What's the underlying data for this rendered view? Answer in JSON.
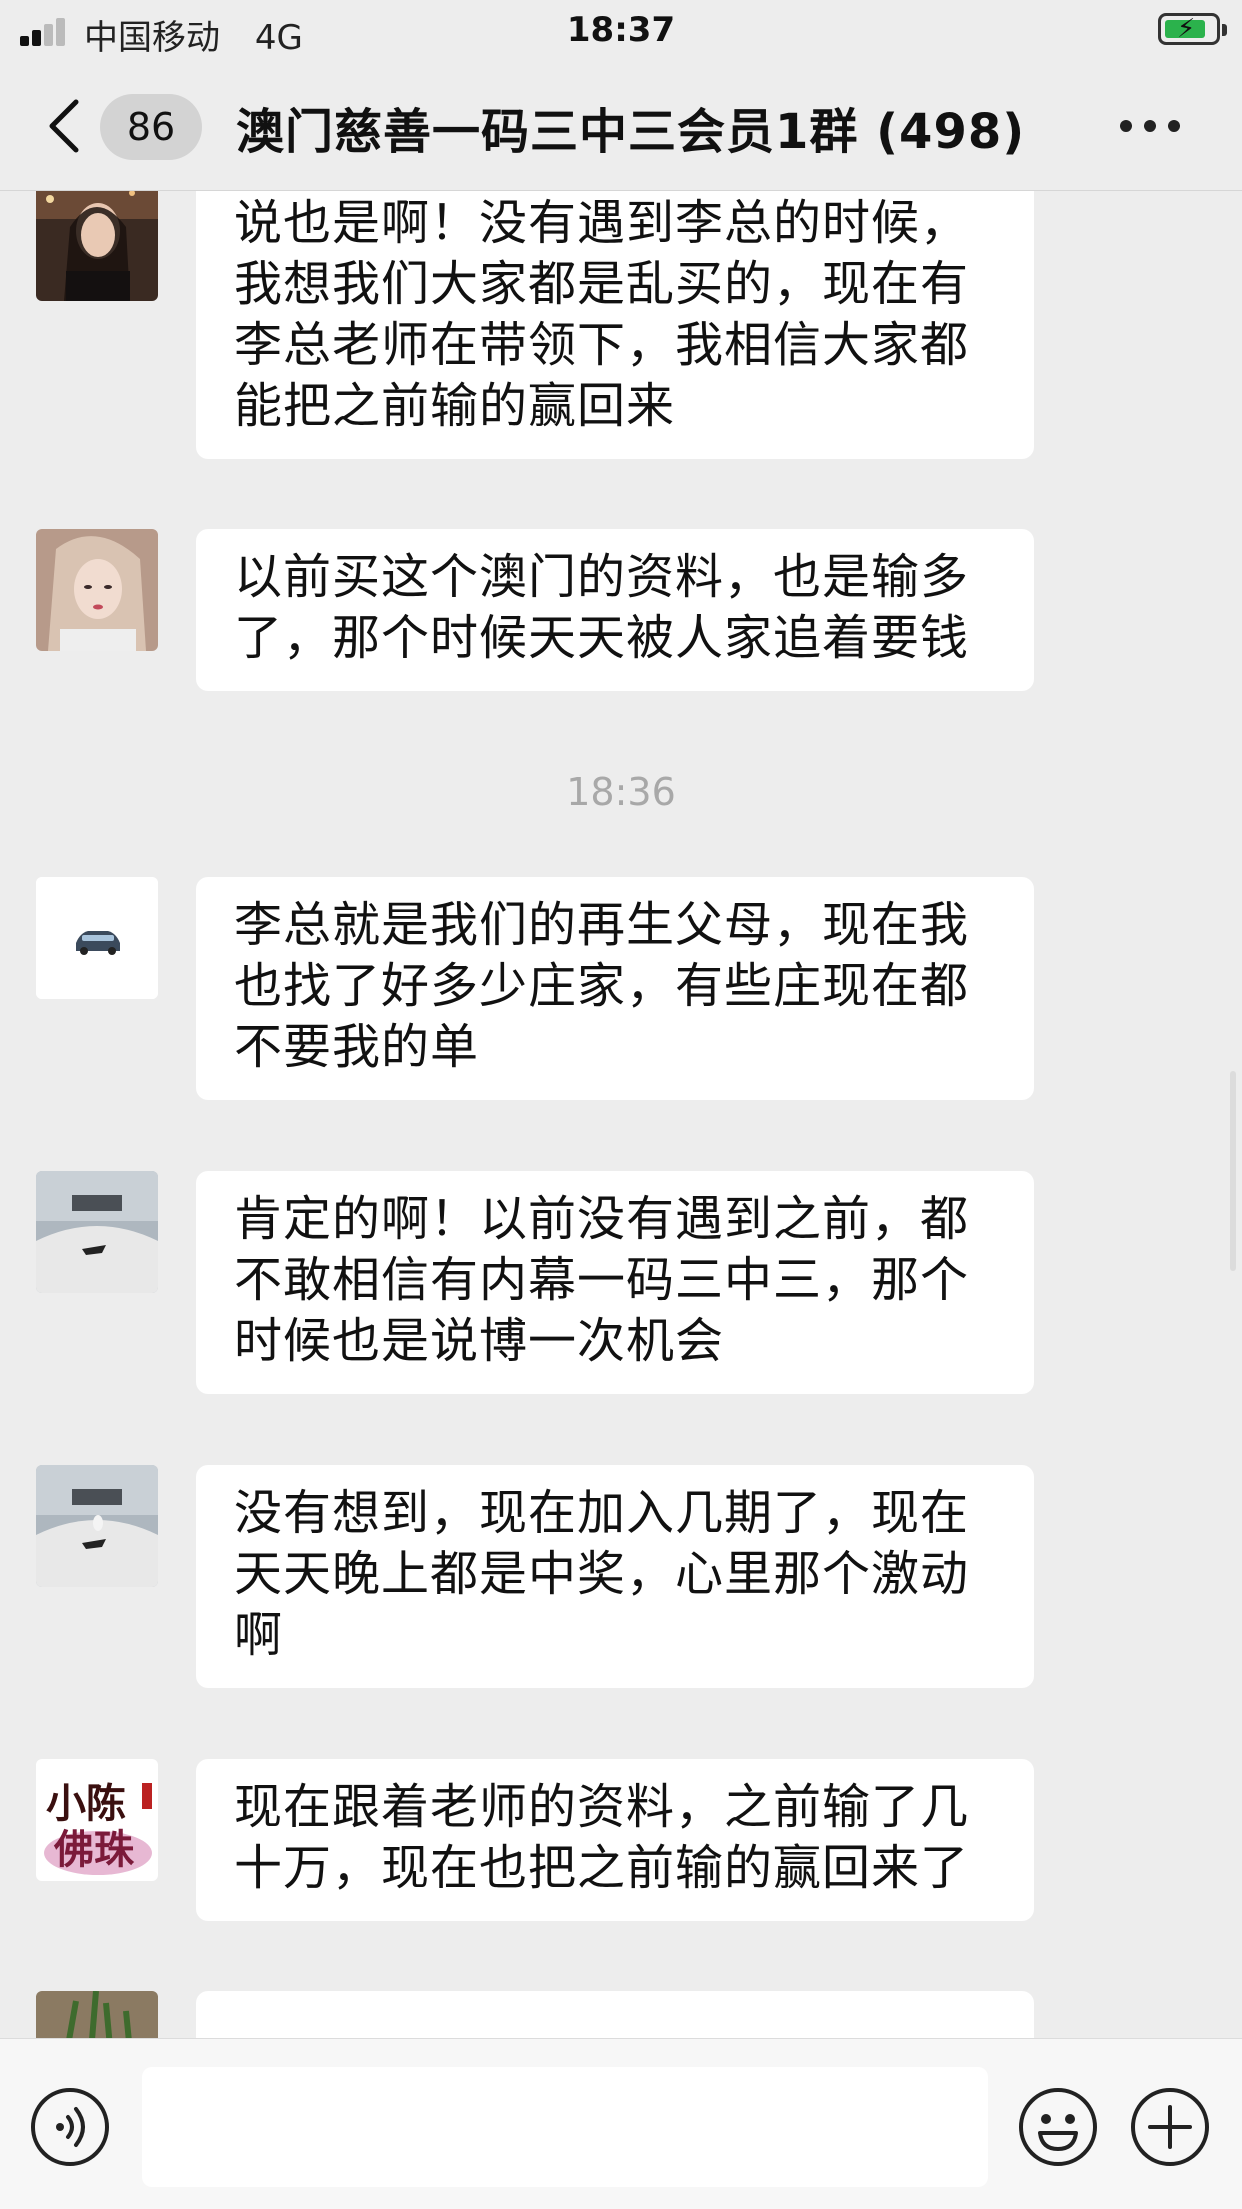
{
  "status_bar": {
    "carrier": "中国移动",
    "network": "4G",
    "time": "18:37",
    "battery_level": 0.7,
    "battery_color": "#2bb24c"
  },
  "nav": {
    "back_icon": "chevron-left-icon",
    "unread_count": "86",
    "title": "澳门慈善一码三中三会员1群 (498)",
    "more_icon": "more-dots-icon"
  },
  "messages": [
    {
      "avatar": "woman-dark-portrait",
      "text": "说也是啊！没有遇到李总的时候，我想我们大家都是乱买的，现在有李总老师在带领下，我相信大家都能把之前输的赢回来"
    },
    {
      "avatar": "woman-blonde-portrait",
      "text": "以前买这个澳门的资料，也是输多了，那个时候天天被人家追着要钱"
    },
    {
      "avatar": "car-icon-avatar",
      "text": "李总就是我们的再生父母，现在我也找了好多少庄家，有些庄现在都不要我的单"
    },
    {
      "avatar": "yacht-photo",
      "text": "肯定的啊！以前没有遇到之前，都不敢相信有内幕一码三中三，那个时候也是说博一次机会"
    },
    {
      "avatar": "yacht-photo",
      "text": "没有想到，现在加入几期了，现在天天晚上都是中奖，心里那个激动啊"
    },
    {
      "avatar": "calligraphy-logo",
      "text": "现在跟着老师的资料，之前输了几十万，现在也把之前输的赢回来了"
    },
    {
      "avatar": "plant-photo",
      "text": ""
    }
  ],
  "time_separator": "18:36",
  "avatar_text": {
    "calligraphy": "小陈佛珠"
  },
  "input_bar": {
    "voice_icon": "voice-icon",
    "emoji_icon": "emoji-icon",
    "plus_icon": "plus-icon",
    "input_value": ""
  }
}
